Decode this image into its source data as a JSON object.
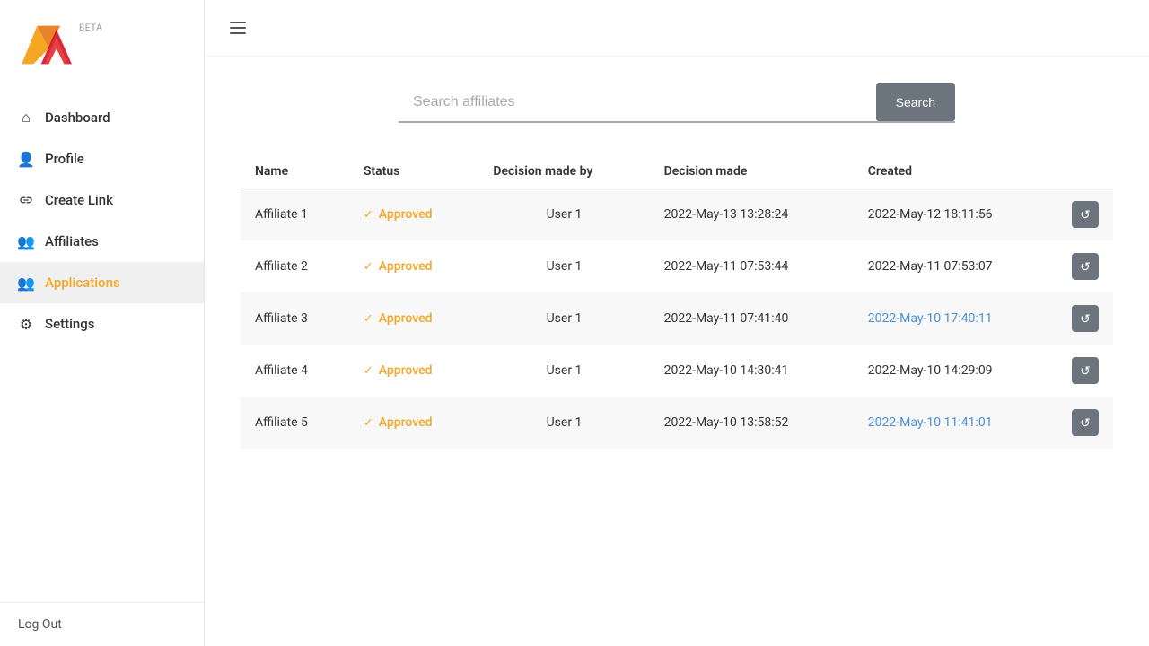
{
  "logo": {
    "beta_label": "BETA"
  },
  "sidebar": {
    "items": [
      {
        "id": "dashboard",
        "label": "Dashboard",
        "icon": "house"
      },
      {
        "id": "profile",
        "label": "Profile",
        "icon": "person"
      },
      {
        "id": "create-link",
        "label": "Create Link",
        "icon": "link"
      },
      {
        "id": "affiliates",
        "label": "Affiliates",
        "icon": "people"
      },
      {
        "id": "applications",
        "label": "Applications",
        "icon": "people-active"
      },
      {
        "id": "settings",
        "label": "Settings",
        "icon": "gear"
      }
    ],
    "logout_label": "Log Out"
  },
  "search": {
    "placeholder": "Search affiliates",
    "button_label": "Search"
  },
  "table": {
    "columns": [
      {
        "id": "name",
        "label": "Name"
      },
      {
        "id": "status",
        "label": "Status"
      },
      {
        "id": "decision_by",
        "label": "Decision made by"
      },
      {
        "id": "decision_made",
        "label": "Decision made"
      },
      {
        "id": "created",
        "label": "Created"
      }
    ],
    "rows": [
      {
        "name": "Affiliate 1",
        "status": "Approved",
        "decision_by": "User 1",
        "decision_made": "2022-May-13 13:28:24",
        "created": "2022-May-12 18:11:56",
        "created_highlight": false
      },
      {
        "name": "Affiliate 2",
        "status": "Approved",
        "decision_by": "User 1",
        "decision_made": "2022-May-11 07:53:44",
        "created": "2022-May-11 07:53:07",
        "created_highlight": false
      },
      {
        "name": "Affiliate 3",
        "status": "Approved",
        "decision_by": "User 1",
        "decision_made": "2022-May-11 07:41:40",
        "created": "2022-May-10 17:40:11",
        "created_highlight": true
      },
      {
        "name": "Affiliate 4",
        "status": "Approved",
        "decision_by": "User 1",
        "decision_made": "2022-May-10 14:30:41",
        "created": "2022-May-10 14:29:09",
        "created_highlight": false
      },
      {
        "name": "Affiliate 5",
        "status": "Approved",
        "decision_by": "User 1",
        "decision_made": "2022-May-10 13:58:52",
        "created": "2022-May-10 11:41:01",
        "created_highlight": true
      }
    ]
  }
}
